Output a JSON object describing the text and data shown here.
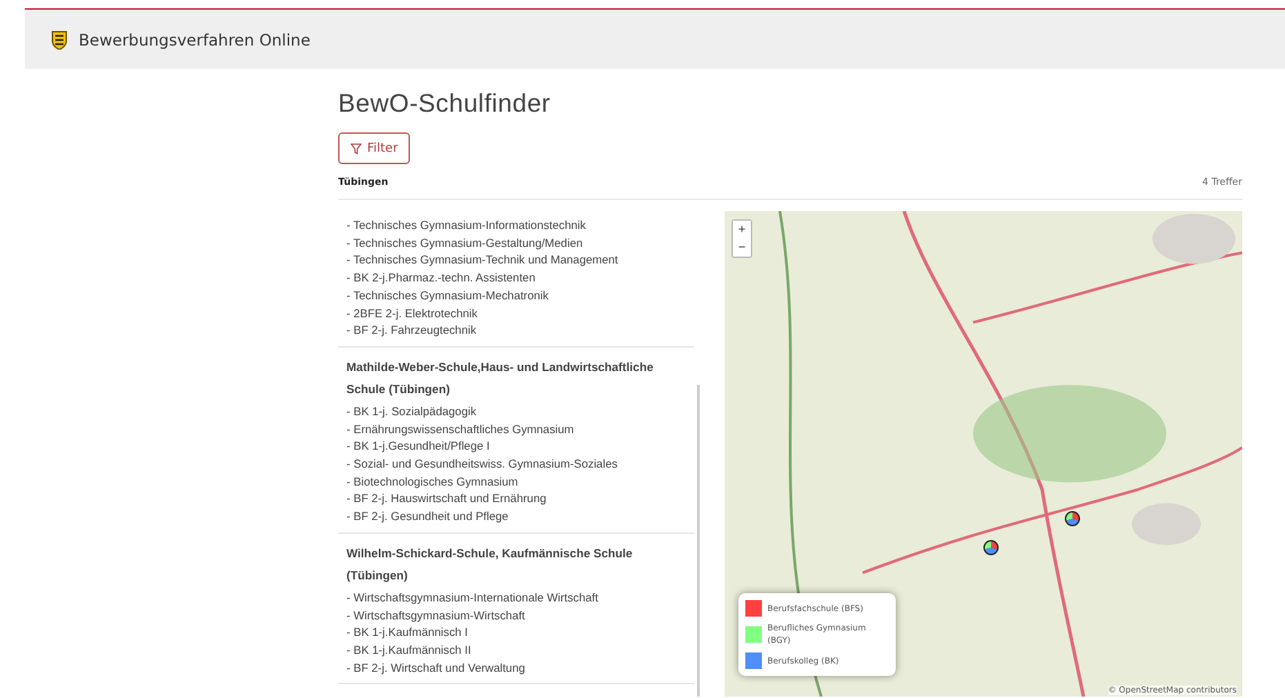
{
  "header": {
    "title": "Bewerbungsverfahren Online"
  },
  "page_title": "BewO-Schulfinder",
  "filter_button": {
    "label": "Filter"
  },
  "location": "Tübingen",
  "result_count": "4 Treffer",
  "schools": [
    {
      "programs": [
        "- Technisches Gymnasium-Informationstechnik",
        "- Technisches Gymnasium-Gestaltung/Medien",
        "- Technisches Gymnasium-Technik und Management",
        "- BK 2-j.Pharmaz.-techn. Assistenten",
        "- Technisches Gymnasium-Mechatronik",
        "- 2BFE 2-j. Elektrotechnik",
        "- BF 2-j. Fahrzeugtechnik"
      ]
    },
    {
      "name": "Mathilde-Weber-Schule,Haus- und Landwirtschaftliche Schule (Tübingen)",
      "programs": [
        "- BK 1-j. Sozialpädagogik",
        "- Ernährungswissenschaftliches Gymnasium",
        "- BK 1-j.Gesundheit/Pflege I",
        "- Sozial- und Gesundheitswiss. Gymnasium-Soziales",
        "- Biotechnologisches Gymnasium",
        "- BF 2-j. Hauswirtschaft und Ernährung",
        "- BF 2-j. Gesundheit und Pflege"
      ]
    },
    {
      "name": "Wilhelm-Schickard-Schule, Kaufmännische Schule (Tübingen)",
      "programs": [
        "- Wirtschaftsgymnasium-Internationale Wirtschaft",
        "- Wirtschaftsgymnasium-Wirtschaft",
        "- BK 1-j.Kaufmännisch I",
        "- BK 1-j.Kaufmännisch II",
        "- BF 2-j. Wirtschaft und Verwaltung"
      ]
    }
  ],
  "map": {
    "zoom_in": "+",
    "zoom_out": "−",
    "attribution": "© OpenStreetMap contributors",
    "legend": [
      {
        "label": "Berufsfachschule (BFS)",
        "color": "#ff4040"
      },
      {
        "label": "Berufliches Gymnasium (BGY)",
        "color": "#80ff80"
      },
      {
        "label": "Berufskolleg (BK)",
        "color": "#4f8ff7"
      }
    ]
  }
}
